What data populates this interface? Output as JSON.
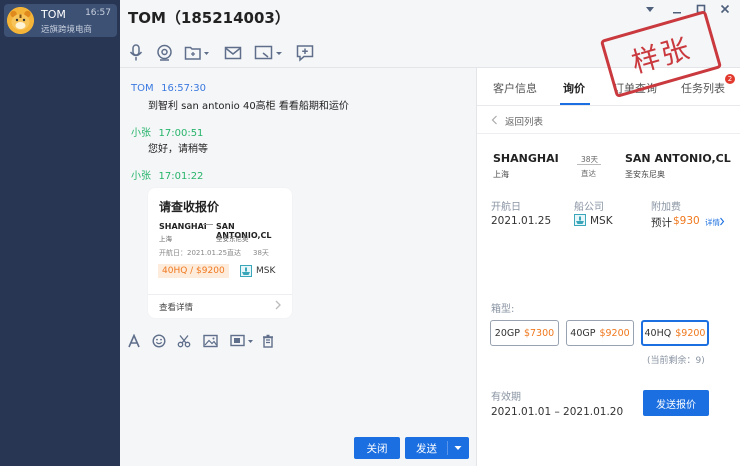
{
  "sidebar": {
    "contact": {
      "name": "TOM",
      "time": "16:57",
      "subtitle": "远旗跨境电商"
    }
  },
  "header": {
    "title": "TOM（185214003）"
  },
  "messages": [
    {
      "sender": "TOM",
      "time": "16:57:30",
      "text": "到智利 san antonio 40高柜  看看船期和运价"
    },
    {
      "sender": "小张",
      "time": "17:00:51",
      "text": "您好，请稍等"
    },
    {
      "sender": "小张",
      "time": "17:01:22"
    }
  ],
  "quote_card": {
    "title": "请查收报价",
    "origin_en": "SHANGHAI",
    "origin_cn": "上海",
    "dest_en": "SAN ANTONIO,CL",
    "dest_cn": "圣安东尼奥",
    "sailing_info": "开航日：2021.01.25",
    "route_type": "直达",
    "transit_days": "38天",
    "price_tag": "40HQ / $9200",
    "carrier": "MSK",
    "detail_link": "查看详情"
  },
  "input_area": {
    "close_label": "关闭",
    "send_label": "发送"
  },
  "panel": {
    "tabs": [
      "客户信息",
      "询价",
      "订单查询",
      "任务列表"
    ],
    "active_tab": 1,
    "badge": "2",
    "back_label": "返回列表",
    "origin_en": "SHANGHAI",
    "origin_cn": "上海",
    "dest_en": "SAN ANTONIO,CL",
    "dest_cn": "圣安东尼奥",
    "transit_days": "38天",
    "route_type": "直达",
    "sailing_label": "开航日",
    "sailing_date": "2021.01.25",
    "carrier_label": "船公司",
    "carrier": "MSK",
    "surcharge_label": "附加费",
    "surcharge_prefix": "预计",
    "surcharge_value": "$930",
    "surcharge_link": "详情",
    "box_label": "箱型:",
    "box_options": [
      {
        "type": "20GP",
        "price": "$7300"
      },
      {
        "type": "40GP",
        "price": "$9200"
      },
      {
        "type": "40HQ",
        "price": "$9200"
      }
    ],
    "selected_box": 2,
    "remaining": "(当前剩余：9)",
    "validity_label": "有效期",
    "validity_value": "2021.01.01 – 2021.01.20",
    "submit_label": "发送报价"
  },
  "stamp_text": "样张",
  "colors": {
    "sidebar_bg": "#283653",
    "accent_blue": "#1b6fe0",
    "sender_green": "#27b46b",
    "price_orange": "#f0781e",
    "stamp_red": "#c9393e"
  }
}
